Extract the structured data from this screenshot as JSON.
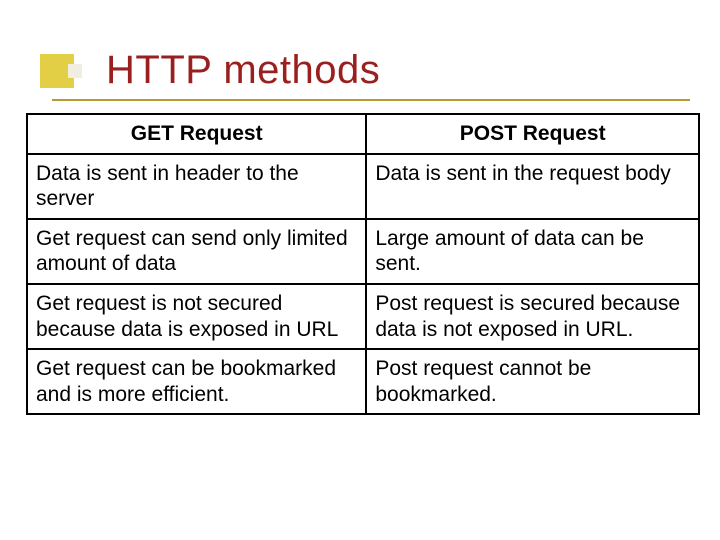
{
  "slide": {
    "title": "HTTP methods"
  },
  "table": {
    "headers": {
      "left": "GET Request",
      "right": "POST Request"
    },
    "rows": [
      {
        "left": "Data is sent in header to the server",
        "right": "Data is sent in the request body"
      },
      {
        "left": "Get request can send only limited amount of data",
        "right": "Large amount of data can be sent."
      },
      {
        "left": "Get request is not secured because data is exposed in URL",
        "right": "Post request is secured because data is not exposed in URL."
      },
      {
        "left": "Get request can be bookmarked and is  more efficient.",
        "right": "Post request cannot be bookmarked."
      }
    ]
  }
}
